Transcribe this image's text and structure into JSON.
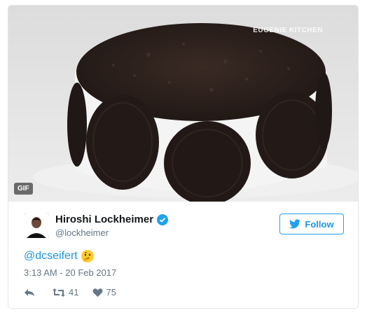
{
  "media": {
    "watermark": "EUGENIE KITCHEN",
    "badge": "GIF"
  },
  "author": {
    "display_name": "Hiroshi Lockheimer",
    "handle": "@lockheimer",
    "verified": true
  },
  "follow_button": {
    "label": "Follow"
  },
  "tweet": {
    "mention": "@dcseifert",
    "emoji": "thinking-face"
  },
  "timestamp": "3:13 AM - 20 Feb 2017",
  "actions": {
    "retweets": "41",
    "likes": "75"
  },
  "colors": {
    "accent": "#1da1f2",
    "link": "#1b95e0",
    "muted": "#657786"
  }
}
